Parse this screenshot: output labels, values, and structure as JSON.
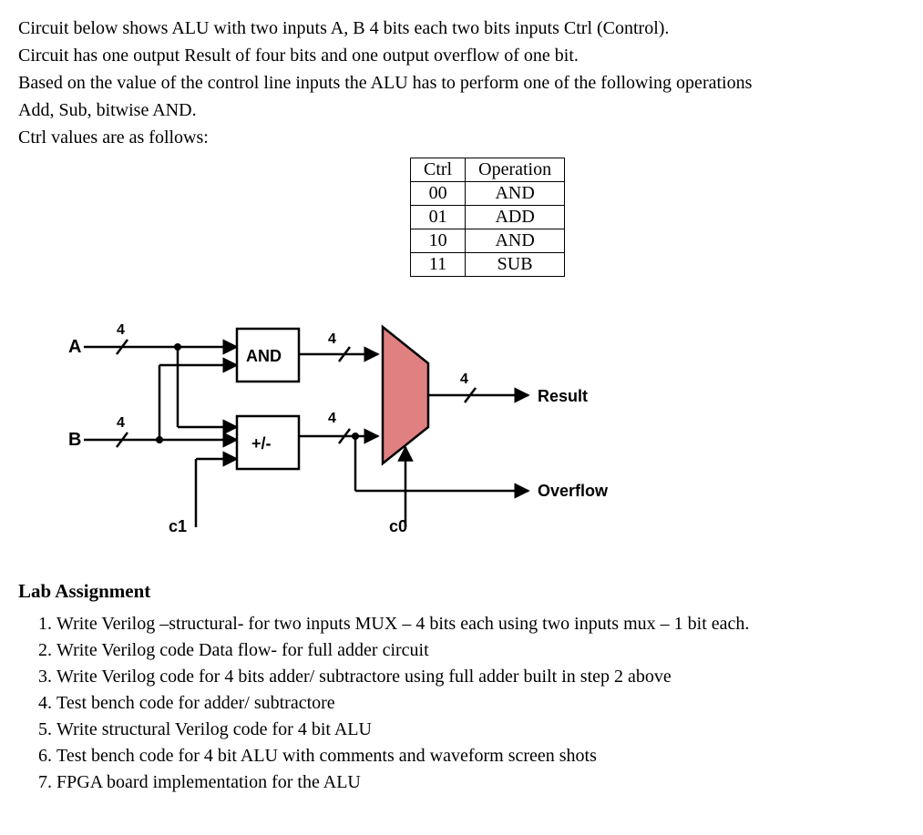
{
  "intro": {
    "l1": "Circuit below shows ALU with two inputs A, B 4 bits each two bits inputs Ctrl (Control).",
    "l2": "Circuit has one output Result of four bits and one output overflow of one bit.",
    "l3": "Based on the value of the control line inputs the ALU has to perform one of the following operations",
    "l4": "Add, Sub, bitwise AND.",
    "l5": "Ctrl values are as follows:"
  },
  "table": {
    "h_ctrl": "Ctrl",
    "h_op": "Operation",
    "rows": [
      {
        "ctrl": "00",
        "op": "AND"
      },
      {
        "ctrl": "01",
        "op": "ADD"
      },
      {
        "ctrl": "10",
        "op": "AND"
      },
      {
        "ctrl": "11",
        "op": "SUB"
      }
    ]
  },
  "diagram": {
    "inA": "A",
    "inB": "B",
    "bus4": "4",
    "and_block": "AND",
    "addsub_block": "+/-",
    "c1": "c1",
    "c0": "c0",
    "result": "Result",
    "overflow": "Overflow"
  },
  "heading": "Lab Assignment",
  "assignments": {
    "i1": "Write Verilog –structural- for two inputs MUX – 4 bits each using two inputs mux – 1 bit each.",
    "i2": "Write Verilog code Data flow- for full adder circuit",
    "i3": "Write Verilog code for 4 bits adder/ subtractore  using full adder  built in step 2 above",
    "i4": "Test bench code for adder/ subtractore",
    "i5": "Write structural Verilog code for 4 bit ALU",
    "i6": "Test bench code for 4 bit ALU with comments and waveform screen shots",
    "i7": "FPGA board implementation for the ALU"
  }
}
